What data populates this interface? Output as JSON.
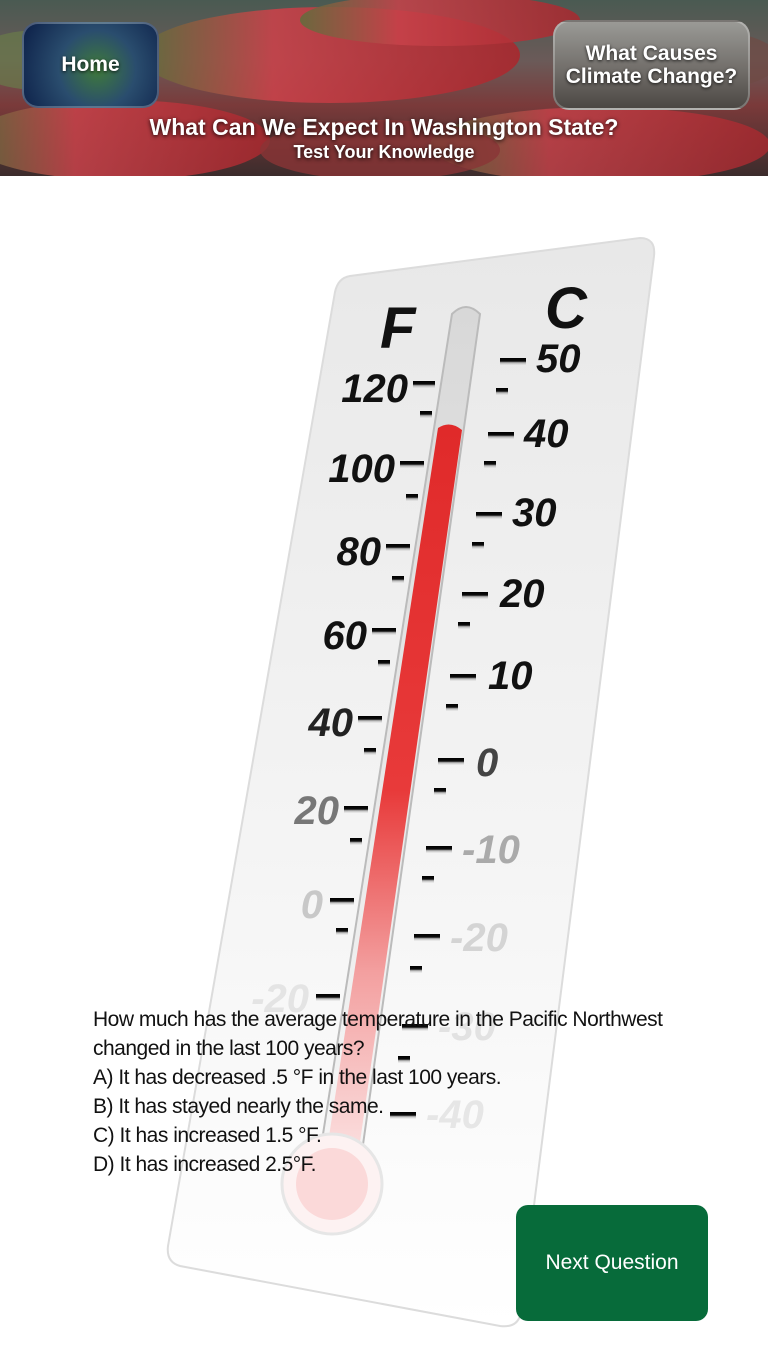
{
  "header": {
    "home_label": "Home",
    "causes_label_line1": "What Causes",
    "causes_label_line2": "Climate Change?",
    "title": "What Can We Expect In Washington State?",
    "subtitle": "Test Your Knowledge"
  },
  "thermometer": {
    "f_label": "F",
    "c_label": "C",
    "f_ticks": [
      "120",
      "100",
      "80",
      "60",
      "40",
      "20",
      "0",
      "-20"
    ],
    "c_ticks": [
      "50",
      "40",
      "30",
      "20",
      "10",
      "0",
      "-10",
      "-20",
      "-30",
      "-40"
    ]
  },
  "quiz": {
    "question_line1": "How much has the average temperature in the Pacific Northwest",
    "question_line2": "changed in the last 100 years?",
    "option_a": "A) It has decreased .5 °F in the last 100 years.",
    "option_b": "B) It has stayed nearly the same.",
    "option_c": "C) It has increased 1.5 °F.",
    "option_d": "D) It has increased 2.5°F."
  },
  "next_button": {
    "label": "Next Question"
  },
  "colors": {
    "accent": "#076b3a",
    "mercury": "#e03030"
  }
}
